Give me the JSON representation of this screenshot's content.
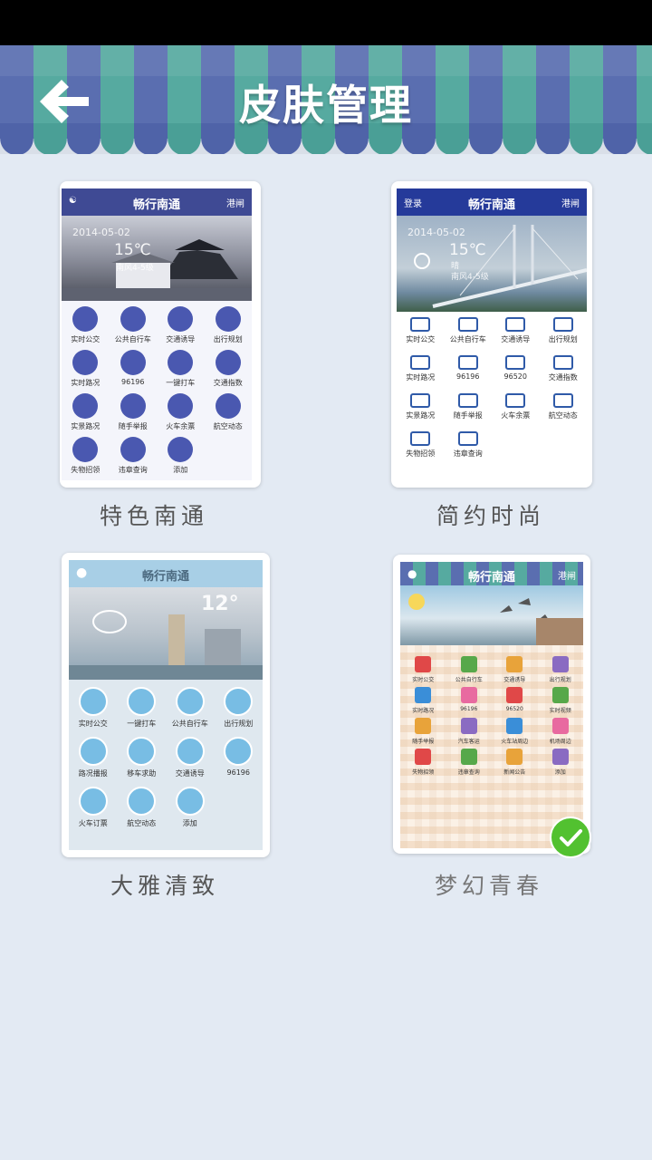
{
  "header": {
    "title": "皮肤管理",
    "back_icon": "back-arrow-icon"
  },
  "skins": [
    {
      "label": "特色南通",
      "app_title": "畅行南通",
      "top_right": "港闸",
      "weather": {
        "date": "2014-05-02",
        "temp": "15℃",
        "desc": "南风4-5级"
      },
      "items": [
        "实时公交",
        "公共自行车",
        "交通诱导",
        "出行规划",
        "实时路况",
        "96196",
        "一键打车",
        "交通指数",
        "实景路况",
        "随手举报",
        "火车余票",
        "航空动态",
        "失物招领",
        "违章查询",
        "添加"
      ]
    },
    {
      "label": "简约时尚",
      "app_title": "畅行南通",
      "top_left": "登录",
      "top_right": "港闸",
      "weather": {
        "date": "2014-05-02",
        "temp": "15℃",
        "cond": "晴",
        "desc": "南风4-5级"
      },
      "items": [
        "实时公交",
        "公共自行车",
        "交通诱导",
        "出行规划",
        "实时路况",
        "96196",
        "96520",
        "交通指数",
        "实景路况",
        "随手举报",
        "火车余票",
        "航空动态",
        "失物招领",
        "违章查询"
      ]
    },
    {
      "label": "大雅清致",
      "app_title": "畅行南通",
      "weather": {
        "temp": "12°"
      },
      "items": [
        "实时公交",
        "一键打车",
        "公共自行车",
        "出行规划",
        "路况播报",
        "移车求助",
        "交通诱导",
        "96196",
        "火车订票",
        "航空动态",
        "添加"
      ]
    },
    {
      "label": "梦幻青春",
      "app_title": "畅行南通",
      "top_right": "港闸",
      "items": [
        "实时公交",
        "公共自行车",
        "交通诱导",
        "出行规划",
        "实时路况",
        "96196",
        "96520",
        "实时视频",
        "随手举报",
        "汽车客运",
        "火车站周边",
        "机场周边",
        "失物招领",
        "违章查询",
        "新闻公告",
        "添加"
      ]
    }
  ],
  "selected_skin": "梦幻青春",
  "colors": {
    "header_blue": "#5a6eb0",
    "header_teal": "#56aaa0",
    "check": "#52c130",
    "background": "#e3eaf3"
  }
}
